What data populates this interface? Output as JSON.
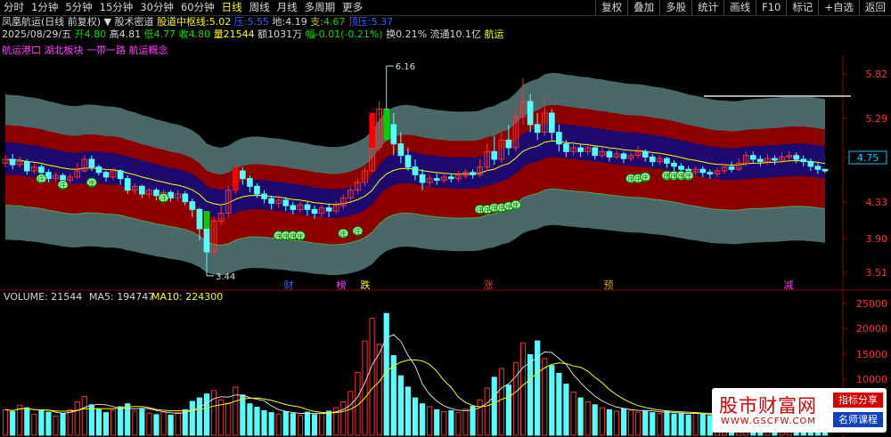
{
  "toolbar": {
    "periods": [
      "分时",
      "1分钟",
      "5分钟",
      "15分钟",
      "30分钟",
      "60分钟",
      "日线",
      "周线",
      "月线",
      "多周期",
      "更多"
    ],
    "active": "日线",
    "right_buttons": [
      "复权",
      "叠加",
      "多股",
      "统计",
      "画线",
      "F10",
      "标记",
      "+自选",
      "返回"
    ]
  },
  "title_bar": {
    "stock": "凤凰航运(日线 前复权)",
    "indicator": "股术密道",
    "mid_label": "股道中枢线:",
    "mid_value": "5.02",
    "p_label": "压:",
    "p_value": "5.55",
    "d_label": "地:",
    "d_value": "4.19",
    "s_label": "支:",
    "s_value": "4.67",
    "z_label": "顶压:",
    "z_value": "5.37"
  },
  "info_bar": {
    "date": "2025/08/29/五",
    "open": "开4.80",
    "high": "高4.81",
    "low": "低4.77",
    "close": "收4.80",
    "volume": "量21544",
    "amount": "额1031万",
    "change": "幅-0.01(-0.21%)",
    "turnover": "换0.21%",
    "float": "流通10.1亿",
    "sector": "航运"
  },
  "concepts": "航运港口 湖北板块 一带一路 航运概念",
  "price_axis": {
    "ticks": [
      "5.82",
      "5.29",
      "4.75",
      "4.33",
      "3.90",
      "3.51"
    ],
    "current": "4.75"
  },
  "annotations": {
    "high": "6.16",
    "low": "3.44",
    "events": [
      "财",
      "榜",
      "跌",
      "涨",
      "预",
      "减"
    ],
    "badge": "庄"
  },
  "volume_panel": {
    "label": "VOLUME: 21544",
    "ma5": "MA5: 194747",
    "ma10": "MA10: 224300",
    "ticks": [
      "25000",
      "20000",
      "15000",
      "10000",
      "5000"
    ]
  },
  "watermark": {
    "title": "股市财富网",
    "url": "WWW.GSCFW.COM",
    "tag1": "指标分享",
    "tag2": "名师课程"
  },
  "colors": {
    "up": "#ff3030",
    "down": "#54ffff",
    "mid_line": "#ffff00",
    "band_outer": "#4b6868",
    "band_inner": "#8c0000"
  },
  "chart_data": {
    "type": "candlestick",
    "price_range": [
      3.3,
      6.3
    ],
    "candles": [
      [
        4.9,
        4.95,
        4.85,
        5.0
      ],
      [
        4.95,
        4.88,
        4.82,
        5.02
      ],
      [
        4.88,
        4.92,
        4.84,
        4.98
      ],
      [
        4.92,
        4.8,
        4.75,
        4.95
      ],
      [
        4.8,
        4.85,
        4.76,
        4.9
      ],
      [
        4.85,
        4.78,
        4.72,
        4.88
      ],
      [
        4.78,
        4.7,
        4.65,
        4.82
      ],
      [
        4.7,
        4.74,
        4.66,
        4.78
      ],
      [
        4.74,
        4.68,
        4.62,
        4.77
      ],
      [
        4.68,
        4.72,
        4.64,
        4.76
      ],
      [
        4.72,
        4.8,
        4.7,
        4.9
      ],
      [
        4.8,
        4.95,
        4.78,
        5.0
      ],
      [
        4.95,
        4.85,
        4.8,
        5.0
      ],
      [
        4.85,
        4.78,
        4.74,
        4.88
      ],
      [
        4.78,
        4.72,
        4.66,
        4.8
      ],
      [
        4.72,
        4.8,
        4.68,
        4.84
      ],
      [
        4.8,
        4.7,
        4.62,
        4.82
      ],
      [
        4.7,
        4.55,
        4.5,
        4.74
      ],
      [
        4.55,
        4.6,
        4.5,
        4.64
      ],
      [
        4.6,
        4.5,
        4.45,
        4.62
      ],
      [
        4.5,
        4.55,
        4.45,
        4.58
      ],
      [
        4.55,
        4.48,
        4.42,
        4.58
      ],
      [
        4.48,
        4.52,
        4.44,
        4.56
      ],
      [
        4.52,
        4.45,
        4.4,
        4.55
      ],
      [
        4.45,
        4.5,
        4.4,
        4.55
      ],
      [
        4.5,
        4.4,
        4.35,
        4.54
      ],
      [
        4.4,
        4.3,
        4.2,
        4.44
      ],
      [
        4.3,
        4.05,
        3.9,
        4.32
      ],
      [
        4.05,
        3.75,
        3.44,
        4.08
      ],
      [
        3.75,
        4.15,
        3.7,
        4.2
      ],
      [
        4.15,
        4.25,
        4.1,
        4.35
      ],
      [
        4.25,
        4.55,
        4.2,
        4.6
      ],
      [
        4.55,
        4.8,
        4.5,
        4.85
      ],
      [
        4.8,
        4.7,
        4.62,
        4.85
      ],
      [
        4.7,
        4.6,
        4.52,
        4.74
      ],
      [
        4.6,
        4.5,
        4.45,
        4.64
      ],
      [
        4.5,
        4.44,
        4.38,
        4.55
      ],
      [
        4.44,
        4.38,
        4.3,
        4.48
      ],
      [
        4.38,
        4.42,
        4.32,
        4.48
      ],
      [
        4.42,
        4.35,
        4.28,
        4.46
      ],
      [
        4.35,
        4.3,
        4.24,
        4.4
      ],
      [
        4.3,
        4.36,
        4.26,
        4.4
      ],
      [
        4.36,
        4.3,
        4.22,
        4.4
      ],
      [
        4.3,
        4.25,
        4.18,
        4.35
      ],
      [
        4.25,
        4.32,
        4.2,
        4.36
      ],
      [
        4.32,
        4.28,
        4.2,
        4.38
      ],
      [
        4.28,
        4.35,
        4.24,
        4.4
      ],
      [
        4.35,
        4.45,
        4.3,
        4.5
      ],
      [
        4.45,
        4.55,
        4.4,
        4.6
      ],
      [
        4.55,
        4.65,
        4.5,
        4.7
      ],
      [
        4.65,
        4.8,
        4.6,
        4.85
      ],
      [
        4.8,
        5.1,
        4.78,
        5.2
      ],
      [
        5.1,
        5.6,
        5.05,
        5.7
      ],
      [
        5.6,
        5.4,
        5.2,
        6.16
      ],
      [
        5.4,
        5.15,
        5.0,
        5.55
      ],
      [
        5.15,
        5.0,
        4.9,
        5.3
      ],
      [
        5.0,
        4.85,
        4.8,
        5.1
      ],
      [
        4.85,
        4.75,
        4.68,
        4.95
      ],
      [
        4.75,
        4.65,
        4.55,
        4.82
      ],
      [
        4.65,
        4.7,
        4.6,
        4.75
      ],
      [
        4.7,
        4.68,
        4.62,
        4.76
      ],
      [
        4.68,
        4.72,
        4.64,
        4.78
      ],
      [
        4.72,
        4.7,
        4.65,
        4.76
      ],
      [
        4.7,
        4.74,
        4.66,
        4.8
      ],
      [
        4.74,
        4.78,
        4.7,
        4.82
      ],
      [
        4.78,
        4.75,
        4.7,
        4.82
      ],
      [
        4.75,
        4.85,
        4.72,
        4.95
      ],
      [
        4.85,
        5.05,
        4.8,
        5.15
      ],
      [
        5.05,
        4.95,
        4.88,
        5.25
      ],
      [
        4.95,
        5.2,
        4.9,
        5.3
      ],
      [
        5.2,
        5.1,
        5.0,
        5.4
      ],
      [
        5.1,
        5.5,
        5.05,
        5.6
      ],
      [
        5.5,
        5.7,
        5.4,
        6.0
      ],
      [
        5.7,
        5.4,
        5.3,
        5.8
      ],
      [
        5.4,
        5.3,
        5.2,
        5.55
      ],
      [
        5.3,
        5.55,
        5.25,
        5.75
      ],
      [
        5.55,
        5.3,
        5.2,
        5.6
      ],
      [
        5.3,
        5.15,
        5.05,
        5.4
      ],
      [
        5.15,
        5.05,
        4.98,
        5.2
      ],
      [
        5.05,
        5.1,
        5.0,
        5.18
      ],
      [
        5.1,
        5.05,
        4.98,
        5.15
      ],
      [
        5.05,
        5.1,
        5.0,
        5.16
      ],
      [
        5.1,
        5.0,
        4.95,
        5.12
      ],
      [
        5.0,
        5.05,
        4.96,
        5.1
      ],
      [
        5.05,
        4.98,
        4.92,
        5.08
      ],
      [
        4.98,
        5.02,
        4.95,
        5.06
      ],
      [
        5.02,
        4.96,
        4.9,
        5.05
      ],
      [
        4.96,
        5.0,
        4.92,
        5.04
      ],
      [
        5.0,
        5.05,
        4.96,
        5.12
      ],
      [
        5.05,
        4.98,
        4.92,
        5.08
      ],
      [
        4.98,
        4.92,
        4.86,
        5.02
      ],
      [
        4.92,
        4.96,
        4.88,
        5.0
      ],
      [
        4.96,
        4.9,
        4.84,
        4.98
      ],
      [
        4.9,
        4.86,
        4.8,
        4.94
      ],
      [
        4.86,
        4.82,
        4.76,
        4.9
      ],
      [
        4.82,
        4.78,
        4.72,
        4.86
      ],
      [
        4.78,
        4.82,
        4.74,
        4.86
      ],
      [
        4.82,
        4.78,
        4.72,
        4.86
      ],
      [
        4.78,
        4.76,
        4.7,
        4.82
      ],
      [
        4.76,
        4.8,
        4.72,
        4.84
      ],
      [
        4.8,
        4.85,
        4.76,
        4.9
      ],
      [
        4.85,
        4.82,
        4.78,
        4.92
      ],
      [
        4.82,
        4.9,
        4.8,
        4.96
      ],
      [
        4.9,
        5.0,
        4.86,
        5.05
      ],
      [
        5.0,
        4.95,
        4.9,
        5.05
      ],
      [
        4.95,
        4.92,
        4.86,
        5.0
      ],
      [
        4.92,
        4.96,
        4.88,
        5.02
      ],
      [
        4.96,
        4.94,
        4.88,
        5.0
      ],
      [
        4.94,
        4.98,
        4.9,
        5.04
      ],
      [
        4.98,
        5.0,
        4.94,
        5.06
      ],
      [
        5.0,
        4.95,
        4.9,
        5.04
      ],
      [
        4.95,
        4.92,
        4.86,
        5.0
      ],
      [
        4.92,
        4.86,
        4.8,
        4.96
      ],
      [
        4.86,
        4.82,
        4.76,
        4.9
      ],
      [
        4.82,
        4.8,
        4.77,
        4.81
      ]
    ],
    "volume": [
      5200,
      4800,
      6100,
      5600,
      4300,
      5000,
      4700,
      3900,
      4400,
      5200,
      6800,
      7900,
      6200,
      5400,
      4600,
      5100,
      5800,
      6400,
      4900,
      5300,
      4500,
      4200,
      4800,
      4100,
      4600,
      5200,
      6900,
      7600,
      8400,
      9100,
      7200,
      6500,
      9800,
      8200,
      6400,
      5700,
      5000,
      4600,
      4300,
      4800,
      4400,
      4100,
      4700,
      4200,
      4500,
      4900,
      5600,
      6800,
      8900,
      12800,
      19200,
      23800,
      18500,
      24800,
      16200,
      12100,
      9800,
      7600,
      6400,
      5800,
      5200,
      4800,
      5000,
      4600,
      5300,
      5900,
      7200,
      9600,
      11800,
      13600,
      10200,
      14800,
      18800,
      16400,
      19200,
      15600,
      14200,
      12600,
      10400,
      8800,
      7600,
      6800,
      6200,
      5600,
      5200,
      4900,
      5400,
      5100,
      4700,
      5000,
      4600,
      4400,
      4800,
      4300,
      4500,
      4100,
      4600,
      4200,
      4000,
      4400,
      4700,
      5100,
      4800,
      5200,
      4600,
      4300,
      4900,
      4500,
      4200,
      4600,
      4000,
      3800,
      4200,
      3900,
      2154
    ]
  }
}
